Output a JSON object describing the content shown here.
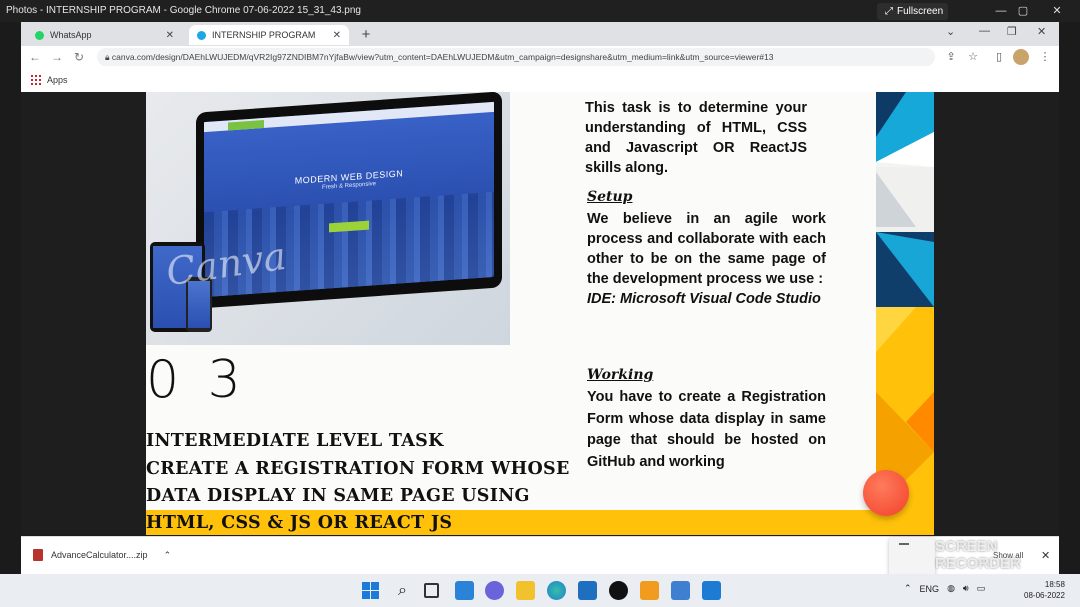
{
  "photos_app": {
    "title": "Photos - INTERNSHIP PROGRAM - Google Chrome 07-06-2022 15_31_43.png",
    "fullscreen_label": "Fullscreen"
  },
  "browser": {
    "tabs": [
      {
        "label": "WhatsApp"
      },
      {
        "label": "INTERNSHIP PROGRAM"
      }
    ],
    "url": "canva.com/design/DAEhLWUJEDM/qVR2Ig97ZNDIBM7nYjfaBw/view?utm_content=DAEhLWUJEDM&utm_campaign=designshare&utm_medium=link&utm_source=viewer#13",
    "bookmarks_apps_label": "Apps"
  },
  "slide": {
    "image": {
      "screen_title": "MODERN WEB DESIGN",
      "screen_subtitle": "Fresh & Responsive",
      "watermark": "Canva"
    },
    "task_number": "0 3",
    "left_lines": [
      "INTERMEDIATE LEVEL TASK",
      "CREATE A REGISTRATION FORM WHOSE",
      "DATA DISPLAY IN SAME PAGE  USING",
      "HTML, CSS & JS OR REACT JS"
    ],
    "intro": "This task is to determine your understanding  of HTML, CSS and Javascript OR ReactJS skills along.",
    "setup_heading": "Setup",
    "setup_text": "We believe in an agile work process and collaborate with each other to be on the same page of the development process we use :",
    "setup_ide": "IDE: Microsoft Visual Code Studio",
    "working_heading": "Working",
    "working_text": "You have to create a Registration Form whose data display in same page that should be hosted on GitHub and working",
    "colors": {
      "band": "#ffc10a",
      "ball": "#f2412a"
    }
  },
  "downloads": {
    "file_name": "AdvanceCalculator....zip",
    "show_all": "Show all"
  },
  "watermark_recorder": "SCREEN RECORDER",
  "taskbar": {
    "language": "ENG",
    "time": "18:58",
    "date": "08-06-2022"
  }
}
